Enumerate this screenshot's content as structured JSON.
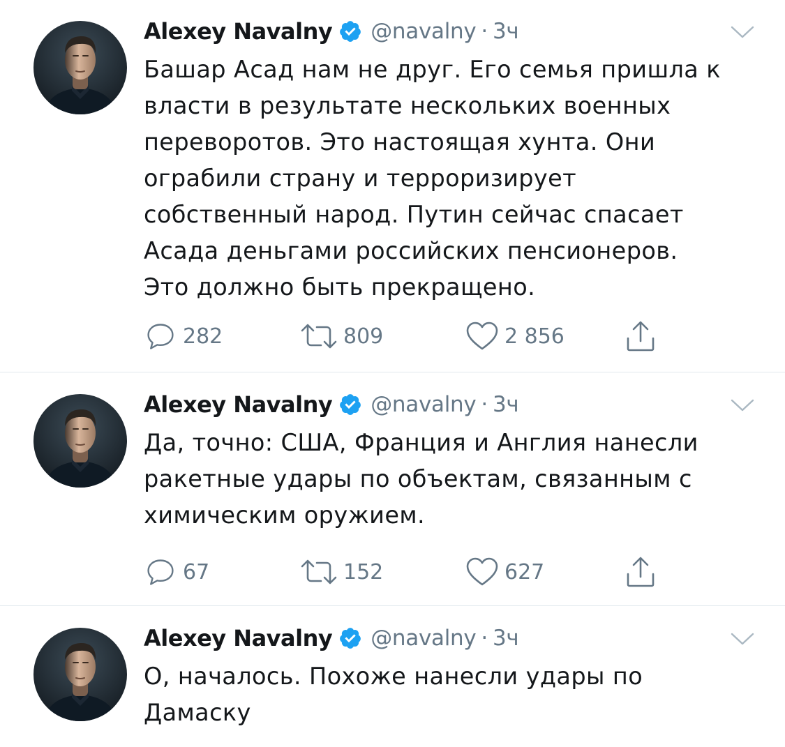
{
  "colors": {
    "text": "#14171a",
    "secondary": "#657786",
    "verified": "#1da1f2",
    "divider": "#e1e8ed"
  },
  "icons": {
    "verified": "verified-badge-icon",
    "menu": "chevron-down-icon",
    "reply": "reply-icon",
    "retweet": "retweet-icon",
    "like": "heart-icon",
    "share": "share-icon"
  },
  "tweets": [
    {
      "name": "Alexey Navalny",
      "handle": "@navalny",
      "separator": "·",
      "time": "3ч",
      "text": "Башар Асад нам не друг. Его семья пришла к\nвласти в результате нескольких военных\nпереворотов. Это настоящая хунта. Они\nограбили страну и терроризирует\nсобственный народ. Путин сейчас спасает\nАсада деньгами российских пенсионеров.\nЭто должно быть прекращено.",
      "replies": "282",
      "retweets": "809",
      "likes": "2 856"
    },
    {
      "name": "Alexey Navalny",
      "handle": "@navalny",
      "separator": "·",
      "time": "3ч",
      "text": "Да, точно: США, Франция и Англия нанесли\nракетные удары по объектам, связанным с\nхимическим оружием.",
      "replies": "67",
      "retweets": "152",
      "likes": "627"
    },
    {
      "name": "Alexey Navalny",
      "handle": "@navalny",
      "separator": "·",
      "time": "3ч",
      "text": "О, началось. Похоже нанесли удары по\nДамаску"
    }
  ]
}
